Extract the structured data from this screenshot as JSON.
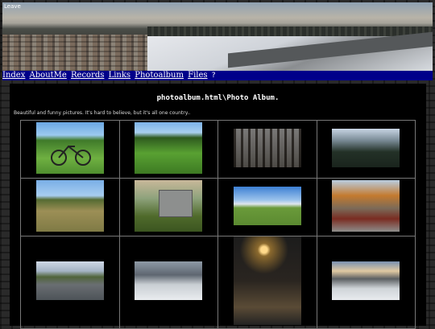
{
  "banner": {
    "label": "Leave"
  },
  "nav": {
    "links": [
      "Index",
      "AboutMe",
      "Records",
      "Links",
      "Photoalbum",
      "Files"
    ],
    "extra_icon": "question-icon"
  },
  "page": {
    "title": "photoalbum.html\\Photo Album.",
    "subtitle": "Beautiful and funny pictures. It's hard to believe, but it's all one country.."
  },
  "photos": [
    [
      "bicycle-on-grass",
      "field-path",
      "winter-trees",
      "forest-trees"
    ],
    [
      "meadow-field",
      "abandoned-shed",
      "green-field-sky",
      "autumn-yard"
    ],
    [
      "river-view",
      "snowy-town",
      "night-streetlight",
      "snowy-road"
    ]
  ]
}
